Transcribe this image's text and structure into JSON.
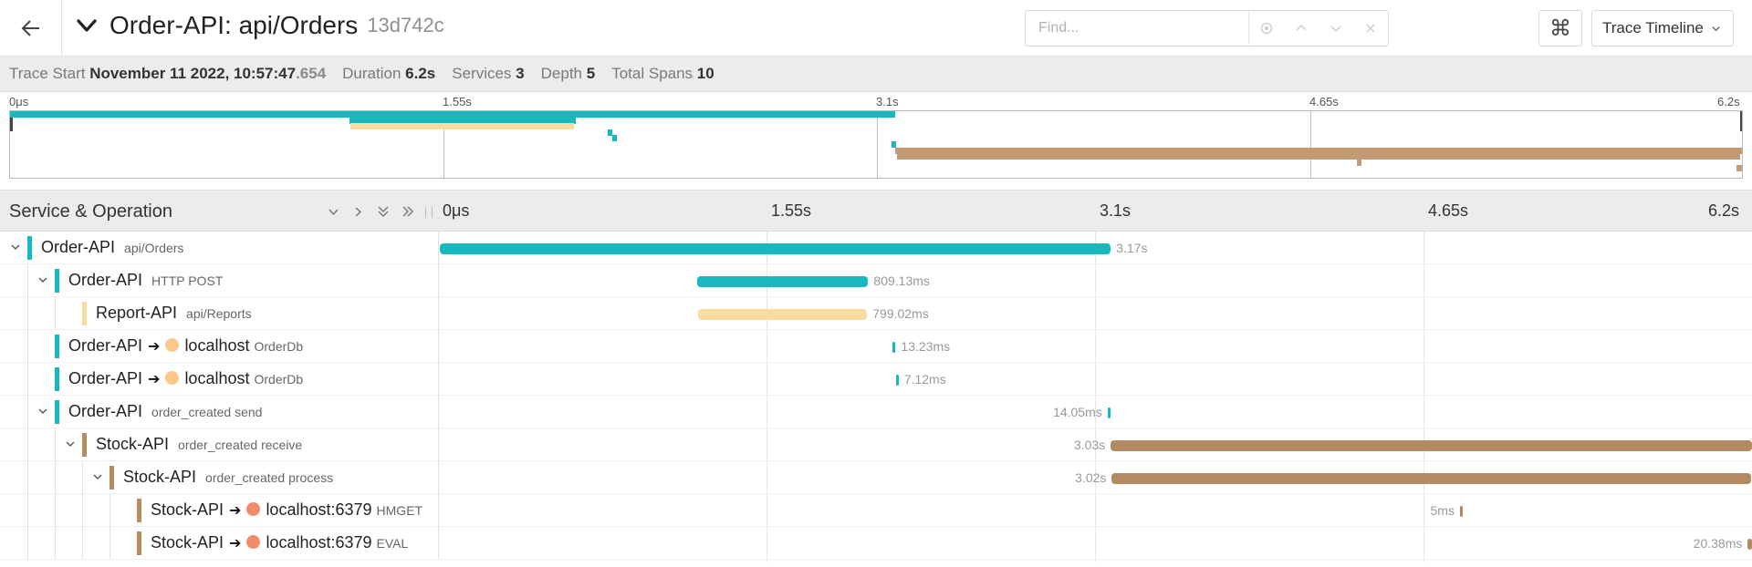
{
  "header": {
    "back_icon": "arrow-left-icon",
    "title": "Order-API: api/Orders",
    "trace_id": "13d742c",
    "find_placeholder": "Find...",
    "keyboard_icon": "command-icon",
    "view_selector": "Trace Timeline"
  },
  "summary": {
    "trace_start_label": "Trace Start",
    "trace_start_value": "November 11 2022, 10:57:47",
    "trace_start_ms": ".654",
    "duration_label": "Duration",
    "duration_value": "6.2s",
    "services_label": "Services",
    "services_value": "3",
    "depth_label": "Depth",
    "depth_value": "5",
    "total_spans_label": "Total Spans",
    "total_spans_value": "10"
  },
  "minimap": {
    "ticks": [
      "0μs",
      "1.55s",
      "3.1s",
      "4.65s",
      "6.2s"
    ]
  },
  "timeline": {
    "column_title": "Service & Operation",
    "ticks": [
      "0μs",
      "1.55s",
      "3.1s",
      "4.65s",
      "6.2s"
    ]
  },
  "colors": {
    "order_api": "#17b8be",
    "report_api": "#f8dca1",
    "stock_api": "#b88c5e",
    "peer_orderdb": "#fcc98a",
    "peer_redis": "#ef8c6a"
  },
  "spans": [
    {
      "service": "Order-API",
      "operation": "api/Orders",
      "duration": "3.17s",
      "start_s": 0.0,
      "dur_s": 3.17,
      "depth": 0,
      "toggle": true,
      "color": "order_api",
      "peer": null
    },
    {
      "service": "Order-API",
      "operation": "HTTP POST",
      "duration": "809.13ms",
      "start_s": 1.215,
      "dur_s": 0.809,
      "depth": 1,
      "toggle": true,
      "color": "order_api",
      "peer": null
    },
    {
      "service": "Report-API",
      "operation": "api/Reports",
      "duration": "799.02ms",
      "start_s": 1.22,
      "dur_s": 0.799,
      "depth": 2,
      "toggle": false,
      "color": "report_api",
      "peer": null
    },
    {
      "service": "Order-API",
      "operation": "OrderDb",
      "duration": "13.23ms",
      "start_s": 2.14,
      "dur_s": 0.01323,
      "depth": 1,
      "toggle": false,
      "color": "order_api",
      "peer": {
        "name": "localhost",
        "dot": "peer_orderdb"
      }
    },
    {
      "service": "Order-API",
      "operation": "OrderDb",
      "duration": "7.12ms",
      "start_s": 2.155,
      "dur_s": 0.00712,
      "depth": 1,
      "toggle": false,
      "color": "order_api",
      "peer": {
        "name": "localhost",
        "dot": "peer_orderdb"
      }
    },
    {
      "service": "Order-API",
      "operation": "order_created send",
      "duration": "14.05ms",
      "start_s": 3.155,
      "dur_s": 0.01405,
      "depth": 1,
      "toggle": true,
      "color": "order_api",
      "peer": null,
      "label_left": true
    },
    {
      "service": "Stock-API",
      "operation": "order_created receive",
      "duration": "3.03s",
      "start_s": 3.17,
      "dur_s": 3.03,
      "depth": 2,
      "toggle": true,
      "color": "stock_api",
      "peer": null,
      "label_left": true
    },
    {
      "service": "Stock-API",
      "operation": "order_created process",
      "duration": "3.02s",
      "start_s": 3.175,
      "dur_s": 3.02,
      "depth": 3,
      "toggle": true,
      "color": "stock_api",
      "peer": null,
      "label_left": true
    },
    {
      "service": "Stock-API",
      "operation": "HMGET",
      "duration": "5ms",
      "start_s": 4.82,
      "dur_s": 0.005,
      "depth": 4,
      "toggle": false,
      "color": "stock_api",
      "peer": {
        "name": "localhost:6379",
        "dot": "peer_redis"
      },
      "label_left": true
    },
    {
      "service": "Stock-API",
      "operation": "EVAL",
      "duration": "20.38ms",
      "start_s": 6.18,
      "dur_s": 0.02038,
      "depth": 4,
      "toggle": false,
      "color": "stock_api",
      "peer": {
        "name": "localhost:6379",
        "dot": "peer_redis"
      },
      "label_left": true
    }
  ]
}
